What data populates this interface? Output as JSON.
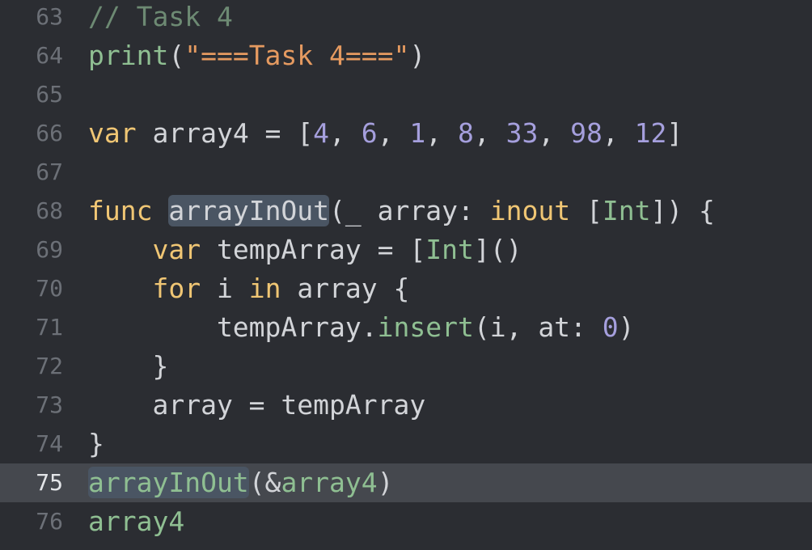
{
  "editor": {
    "lines": [
      {
        "number": "63",
        "current": false,
        "tokens": [
          {
            "text": "// Task 4",
            "type": "comment"
          }
        ]
      },
      {
        "number": "64",
        "current": false,
        "tokens": [
          {
            "text": "print",
            "type": "fn"
          },
          {
            "text": "(",
            "type": "plain"
          },
          {
            "text": "\"===Task 4===\"",
            "type": "str"
          },
          {
            "text": ")",
            "type": "plain"
          }
        ]
      },
      {
        "number": "65",
        "current": false,
        "tokens": []
      },
      {
        "number": "66",
        "current": false,
        "tokens": [
          {
            "text": "var",
            "type": "kw"
          },
          {
            "text": " array4 = [",
            "type": "plain"
          },
          {
            "text": "4",
            "type": "num"
          },
          {
            "text": ", ",
            "type": "plain"
          },
          {
            "text": "6",
            "type": "num"
          },
          {
            "text": ", ",
            "type": "plain"
          },
          {
            "text": "1",
            "type": "num"
          },
          {
            "text": ", ",
            "type": "plain"
          },
          {
            "text": "8",
            "type": "num"
          },
          {
            "text": ", ",
            "type": "plain"
          },
          {
            "text": "33",
            "type": "num"
          },
          {
            "text": ", ",
            "type": "plain"
          },
          {
            "text": "98",
            "type": "num"
          },
          {
            "text": ", ",
            "type": "plain"
          },
          {
            "text": "12",
            "type": "num"
          },
          {
            "text": "]",
            "type": "plain"
          }
        ]
      },
      {
        "number": "67",
        "current": false,
        "tokens": []
      },
      {
        "number": "68",
        "current": false,
        "tokens": [
          {
            "text": "func",
            "type": "kw"
          },
          {
            "text": " ",
            "type": "plain"
          },
          {
            "text": "arrayInOut",
            "type": "plain",
            "highlight": true
          },
          {
            "text": "(_ array: ",
            "type": "plain"
          },
          {
            "text": "inout",
            "type": "kw"
          },
          {
            "text": " [",
            "type": "plain"
          },
          {
            "text": "Int",
            "type": "type"
          },
          {
            "text": "]) {",
            "type": "plain"
          }
        ]
      },
      {
        "number": "69",
        "current": false,
        "tokens": [
          {
            "text": "    ",
            "type": "plain"
          },
          {
            "text": "var",
            "type": "kw"
          },
          {
            "text": " tempArray = [",
            "type": "plain"
          },
          {
            "text": "Int",
            "type": "type"
          },
          {
            "text": "]()",
            "type": "plain"
          }
        ]
      },
      {
        "number": "70",
        "current": false,
        "tokens": [
          {
            "text": "    ",
            "type": "plain"
          },
          {
            "text": "for",
            "type": "kw"
          },
          {
            "text": " i ",
            "type": "plain"
          },
          {
            "text": "in",
            "type": "kw"
          },
          {
            "text": " array {",
            "type": "plain"
          }
        ]
      },
      {
        "number": "71",
        "current": false,
        "tokens": [
          {
            "text": "        tempArray.",
            "type": "plain"
          },
          {
            "text": "insert",
            "type": "fn"
          },
          {
            "text": "(i, at: ",
            "type": "plain"
          },
          {
            "text": "0",
            "type": "num"
          },
          {
            "text": ")",
            "type": "plain"
          }
        ]
      },
      {
        "number": "72",
        "current": false,
        "tokens": [
          {
            "text": "    }",
            "type": "plain"
          }
        ]
      },
      {
        "number": "73",
        "current": false,
        "tokens": [
          {
            "text": "    array = tempArray",
            "type": "plain"
          }
        ]
      },
      {
        "number": "74",
        "current": false,
        "tokens": [
          {
            "text": "}",
            "type": "plain"
          }
        ]
      },
      {
        "number": "75",
        "current": true,
        "tokens": [
          {
            "text": "arrayInOut",
            "type": "fn",
            "highlight": true
          },
          {
            "text": "(&",
            "type": "plain"
          },
          {
            "text": "array4",
            "type": "fn"
          },
          {
            "text": ")",
            "type": "plain"
          }
        ]
      },
      {
        "number": "76",
        "current": false,
        "tokens": [
          {
            "text": "array4",
            "type": "fn"
          }
        ]
      }
    ]
  }
}
